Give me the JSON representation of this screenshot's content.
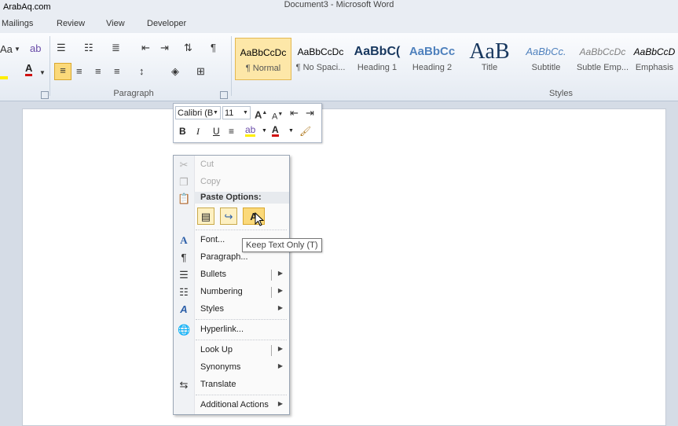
{
  "watermark": "ArabAq.com",
  "window": {
    "title": "Document3 - Microsoft Word"
  },
  "tabs": [
    "Mailings",
    "Review",
    "View",
    "Developer"
  ],
  "ribbon": {
    "groups": {
      "paragraph": "Paragraph",
      "styles": "Styles"
    },
    "styles": [
      {
        "sample": "AaBbCcDc",
        "name": "¶ Normal",
        "active": true
      },
      {
        "sample": "AaBbCcDc",
        "name": "¶ No Spaci..."
      },
      {
        "sample": "AaBbC(",
        "name": "Heading 1"
      },
      {
        "sample": "AaBbCc",
        "name": "Heading 2"
      },
      {
        "sample": "AaB",
        "name": "Title"
      },
      {
        "sample": "AaBbCc.",
        "name": "Subtitle"
      },
      {
        "sample": "AaBbCcDc",
        "name": "Subtle Emp..."
      },
      {
        "sample": "AaBbCcD",
        "name": "Emphasis"
      }
    ],
    "font_partial": "Aa",
    "colors": {
      "highlight": "#ffee00",
      "font_color": "#d01010"
    }
  },
  "mini_toolbar": {
    "font": "Calibri (B",
    "size": "11",
    "bold": "B",
    "italic": "I",
    "underline": "U",
    "font_color_glyph": "A"
  },
  "context_menu": {
    "cut": "Cut",
    "copy": "Copy",
    "paste_options": "Paste Options:",
    "font": "Font...",
    "paragraph": "Paragraph...",
    "bullets": "Bullets",
    "numbering": "Numbering",
    "styles": "Styles",
    "hyperlink": "Hyperlink...",
    "look_up": "Look Up",
    "synonyms": "Synonyms",
    "translate": "Translate",
    "additional_actions": "Additional Actions"
  },
  "tooltip": "Keep Text Only (T)"
}
